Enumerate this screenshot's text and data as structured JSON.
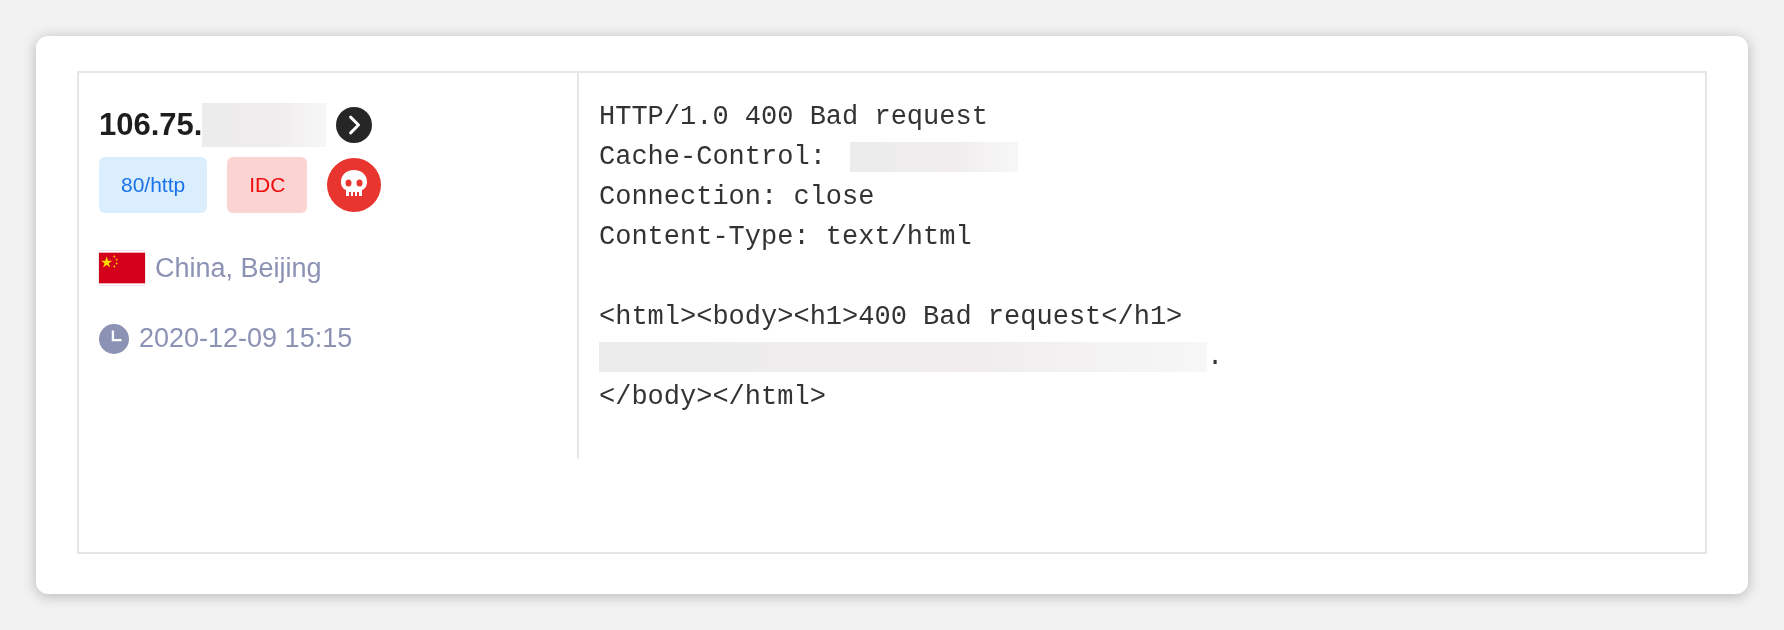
{
  "host": {
    "ip": "106.75.",
    "ip_redacted": true,
    "tags": [
      {
        "kind": "port",
        "text": "80/http"
      },
      {
        "kind": "idc",
        "text": "IDC"
      },
      {
        "kind": "malware"
      }
    ],
    "location": "China, Beijing",
    "time": "2020-12-09 15:15"
  },
  "response": {
    "lines": [
      {
        "kind": "text",
        "parts": [
          {
            "kind": "text",
            "text": "HTTP/1.0 400 Bad request"
          }
        ]
      },
      {
        "kind": "text",
        "parts": [
          {
            "kind": "text",
            "text": "Cache-Control:"
          },
          {
            "kind": "redacted"
          }
        ]
      },
      {
        "kind": "text",
        "parts": [
          {
            "kind": "text",
            "text": "Connection: close"
          }
        ]
      },
      {
        "kind": "text",
        "parts": [
          {
            "kind": "text",
            "text": "Content-Type: text/html"
          }
        ]
      },
      {
        "kind": "blank"
      },
      {
        "kind": "text",
        "parts": [
          {
            "kind": "text",
            "text": "<html><body><h1>400 Bad request</h1>"
          }
        ]
      },
      {
        "kind": "text",
        "parts": [
          {
            "kind": "redacted"
          },
          {
            "kind": "text",
            "text": "."
          }
        ]
      },
      {
        "kind": "text",
        "parts": [
          {
            "kind": "text",
            "text": "</body></html>"
          }
        ]
      }
    ]
  }
}
